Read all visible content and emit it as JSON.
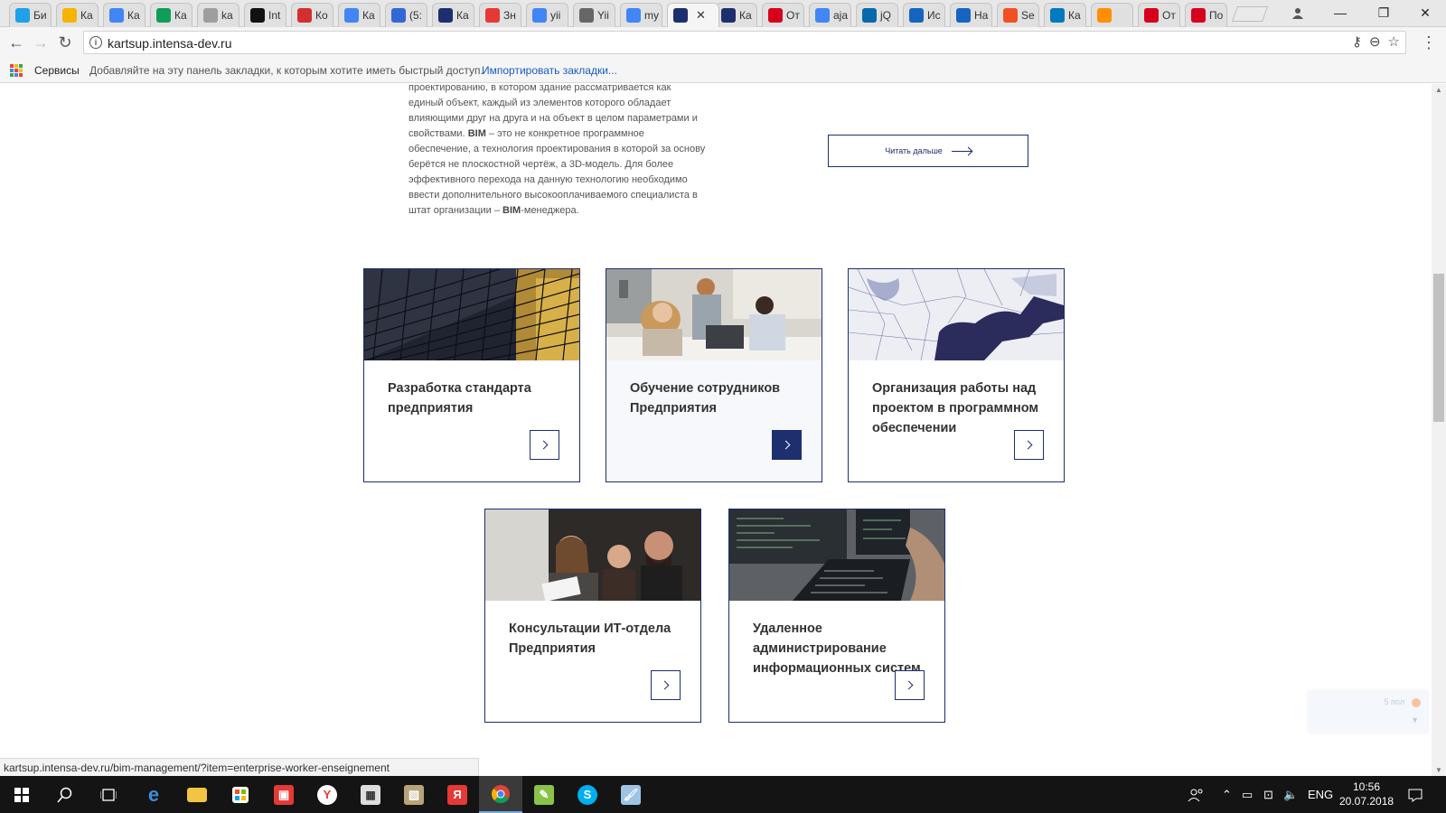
{
  "browser": {
    "tabs": [
      {
        "title": "Би",
        "icon": "skype-blue-icon",
        "color": "#1ea1e6"
      },
      {
        "title": "Ка",
        "icon": "google-drive-icon",
        "color": "#f4b400"
      },
      {
        "title": "Ка",
        "icon": "google-docs-icon",
        "color": "#4285f4"
      },
      {
        "title": "Ка",
        "icon": "google-sheets-icon",
        "color": "#0f9d58"
      },
      {
        "title": "ka",
        "icon": "blank-page-icon",
        "color": "#9e9e9e"
      },
      {
        "title": "Int",
        "icon": "intercom-icon",
        "color": "#111111"
      },
      {
        "title": "Ко",
        "icon": "red-logo-icon",
        "color": "#d32f2f"
      },
      {
        "title": "Ка",
        "icon": "google-docs-icon",
        "color": "#4285f4"
      },
      {
        "title": "(5:",
        "icon": "mail-icon",
        "color": "#3367d6"
      },
      {
        "title": "Ка",
        "icon": "k-logo-icon",
        "color": "#1d2f6e"
      },
      {
        "title": "Зн",
        "icon": "heart-icon",
        "color": "#e53935"
      },
      {
        "title": "yii",
        "icon": "google-icon",
        "color": "#4285f4"
      },
      {
        "title": "Yii",
        "icon": "code-icon",
        "color": "#666666"
      },
      {
        "title": "my",
        "icon": "google-icon",
        "color": "#4285f4"
      },
      {
        "title": "",
        "icon": "k-logo-icon",
        "color": "#1d2f6e",
        "active": true
      },
      {
        "title": "Ка",
        "icon": "k-logo-icon",
        "color": "#1d2f6e"
      },
      {
        "title": "От",
        "icon": "hh-icon",
        "color": "#d6001c"
      },
      {
        "title": "aja",
        "icon": "google-icon",
        "color": "#4285f4"
      },
      {
        "title": "jQ",
        "icon": "jquery-icon",
        "color": "#0769ad"
      },
      {
        "title": "Ис",
        "icon": "history-icon",
        "color": "#1565c0"
      },
      {
        "title": "На",
        "icon": "settings-icon",
        "color": "#1565c0"
      },
      {
        "title": "Se",
        "icon": "microsoft-icon",
        "color": "#f25022"
      },
      {
        "title": "Ка",
        "icon": "trello-icon",
        "color": "#0079bf"
      },
      {
        "title": "",
        "icon": "music-icon",
        "color": "#ff8f00"
      },
      {
        "title": "От",
        "icon": "hh-icon",
        "color": "#d6001c"
      },
      {
        "title": "По",
        "icon": "hh-icon",
        "color": "#d6001c"
      }
    ],
    "url": "kartsup.intensa-dev.ru",
    "bookmarks": {
      "services": "Сервисы",
      "hint": "Добавляйте на эту панель закладки, к которым хотите иметь быстрый доступ.",
      "import": "Импортировать закладки..."
    },
    "status_url": "kartsup.intensa-dev.ru/bim-management/?item=enterprise-worker-enseignement"
  },
  "article": {
    "lines": [
      "проектированию, в котором здание рассматривается как",
      "единый объект, каждый из элементов которого обладает",
      "влияющими друг на друга и на объект в целом параметрами и",
      "свойствами. ",
      "BIM",
      " – это не конкретное программное",
      "обеспечение, а технология проектирования в которой за основу",
      "берётся не плоскостной чертёж, а 3D-модель. Для более",
      "эффективного перехода на данную технологию необходимо",
      "ввести дополнительного высокооплачиваемого специалиста в",
      "штат организации – ",
      "BIM",
      "-менеджера."
    ],
    "read_more": "Читать дальше"
  },
  "cards": [
    {
      "title": "Разработка стандарта предприятия",
      "image": "building-facade"
    },
    {
      "title": "Обучение сотрудников Предприятия",
      "image": "office-team"
    },
    {
      "title": "Организация работы над проектом в программном обеспечении",
      "image": "city-map"
    },
    {
      "title": "Консультации ИТ-отдела Предприятия",
      "image": "people-at-screen"
    },
    {
      "title": "Удаленное администрирование информационных систем",
      "image": "laptop-code"
    }
  ],
  "widget": {
    "text": "5 пол"
  },
  "taskbar": {
    "language": "ENG",
    "time": "10:56",
    "date": "20.07.2018"
  },
  "colors": {
    "accent": "#1d2f6e",
    "text": "#333333"
  }
}
